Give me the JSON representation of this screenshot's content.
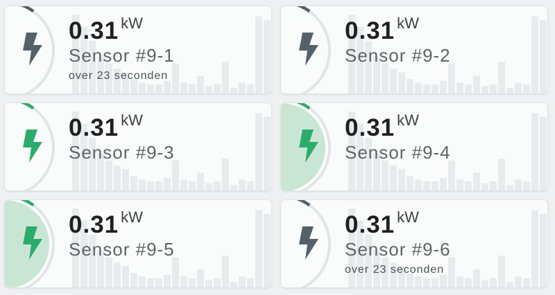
{
  "cards": [
    {
      "value": "0.31",
      "unit": "kW",
      "name": "Sensor #9-1",
      "updated": "over 23 seconden",
      "active": false,
      "progress": 0.2
    },
    {
      "value": "0.31",
      "unit": "kW",
      "name": "Sensor #9-2",
      "updated": "",
      "active": false,
      "progress": 0.2
    },
    {
      "value": "0.31",
      "unit": "kW",
      "name": "Sensor #9-3",
      "updated": "",
      "active": true,
      "progress": 0.2
    },
    {
      "value": "0.31",
      "unit": "kW",
      "name": "Sensor #9-4",
      "updated": "",
      "active": true,
      "progress": 0.2
    },
    {
      "value": "0.31",
      "unit": "kW",
      "name": "Sensor #9-5",
      "updated": "",
      "active": true,
      "progress": 0.2
    },
    {
      "value": "0.31",
      "unit": "kW",
      "name": "Sensor #9-6",
      "updated": "over 23 seconden",
      "active": false,
      "progress": 0.2
    }
  ],
  "history": [
    0.92,
    0.78,
    0.62,
    0.44,
    0.36,
    0.3,
    0.26,
    0.18,
    0.14,
    0.12,
    0.12,
    0.16,
    0.36,
    0.14,
    0.12,
    0.22,
    0.1,
    0.12,
    0.38,
    0.08,
    0.14,
    0.12,
    0.9,
    0.86
  ],
  "colors": {
    "active": "#2cac6b",
    "inactive": "#546169",
    "active_fill": "#c9e6d5",
    "ring_track": "#e2e5e8",
    "bar": "#e6ebee"
  }
}
